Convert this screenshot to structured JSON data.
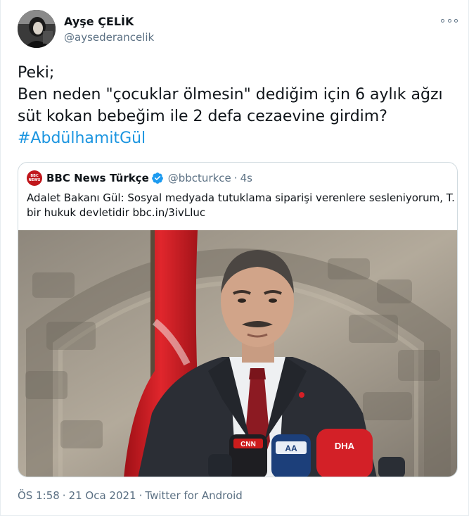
{
  "author": {
    "name": "Ayşe ÇELİK",
    "handle": "@aysederancelik"
  },
  "tweet": {
    "lines": [
      "Peki;",
      "Ben neden \"çocuklar ölmesin\" dediğim için 6 aylık ağzı",
      "süt kokan bebeğim ile 2 defa cezaevine girdim?"
    ],
    "hashtag": "#AbdülhamitGül"
  },
  "quote": {
    "logo_text_line1": "BBC",
    "logo_text_line2": "NEWS",
    "name": "BBC News Türkçe",
    "handle": "@bbcturkce",
    "separator": "·",
    "time": "4s",
    "lines": [
      "Adalet Bakanı Gül: Sosyal medyada tutuklama siparişi verenlere sesleniyorum, T. C.",
      "bir hukuk devletidir bbc.in/3ivLluc"
    ],
    "media_icon": "photo-of-man-at-podium-with-turkish-flag",
    "mic_labels": [
      "CNN",
      "AA",
      "DHA"
    ]
  },
  "footer": {
    "time": "ÖS 1:58",
    "sep1": "·",
    "date": "21 Oca 2021",
    "sep2": "·",
    "source": "Twitter for Android"
  },
  "colors": {
    "link": "#1b95e0",
    "secondary_text": "#5b7083",
    "border": "#cfd9de",
    "flag_red": "#d51f26"
  }
}
